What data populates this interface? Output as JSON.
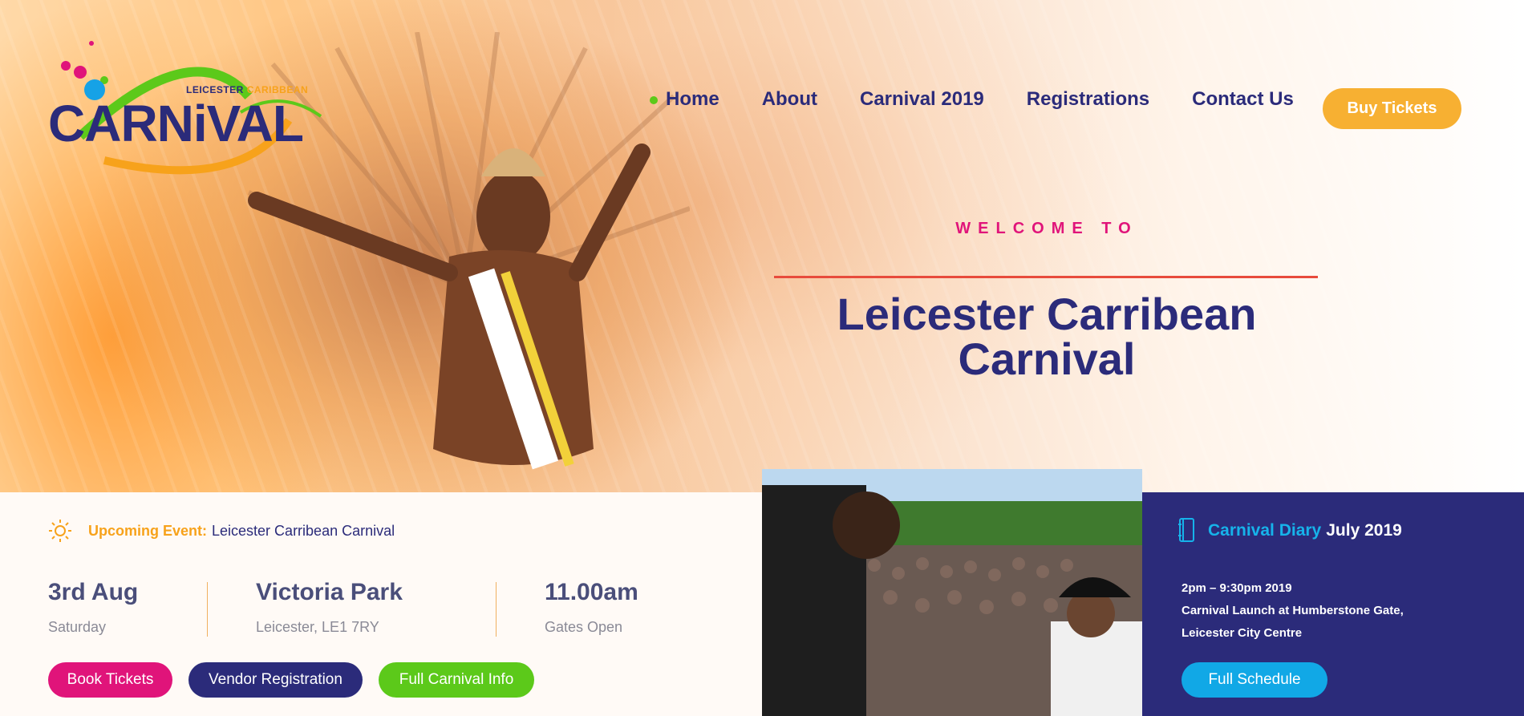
{
  "logo": {
    "small_text_1": "LEICESTER",
    "small_text_2": "CARIBBEAN",
    "main_text": "CARNiVAL"
  },
  "nav": {
    "items": [
      {
        "label": "Home",
        "active": true
      },
      {
        "label": "About"
      },
      {
        "label": "Carnival 2019"
      },
      {
        "label": "Registrations"
      },
      {
        "label": "Contact Us"
      }
    ],
    "cta_label": "Buy Tickets"
  },
  "hero": {
    "welcome": "WELCOME TO",
    "title_line_1": "Leicester Carribean",
    "title_line_2": "Carnival"
  },
  "event": {
    "upcoming_label": "Upcoming Event:",
    "upcoming_value": "Leicester Carribean Carnival",
    "date": "3rd Aug",
    "day": "Saturday",
    "venue": "Victoria Park",
    "address": "Leicester, LE1 7RY",
    "time": "11.00am",
    "time_note": "Gates Open",
    "buttons": [
      "Book Tickets",
      "Vendor Registration",
      "Full Carnival Info"
    ]
  },
  "diary": {
    "label": "Carnival Diary",
    "month": "July 2019",
    "time": "2pm – 9:30pm 2019",
    "line_1": "Carnival Launch at Humberstone Gate,",
    "line_2": "Leicester City Centre",
    "button": "Full Schedule"
  },
  "colors": {
    "brand_navy": "#2b2b7a",
    "accent_orange": "#f7b032",
    "accent_pink": "#e0147a",
    "accent_green": "#5cc91a",
    "accent_blue": "#11a8e6"
  },
  "icons": [
    "sun-icon",
    "book-icon",
    "active-dot-icon"
  ]
}
